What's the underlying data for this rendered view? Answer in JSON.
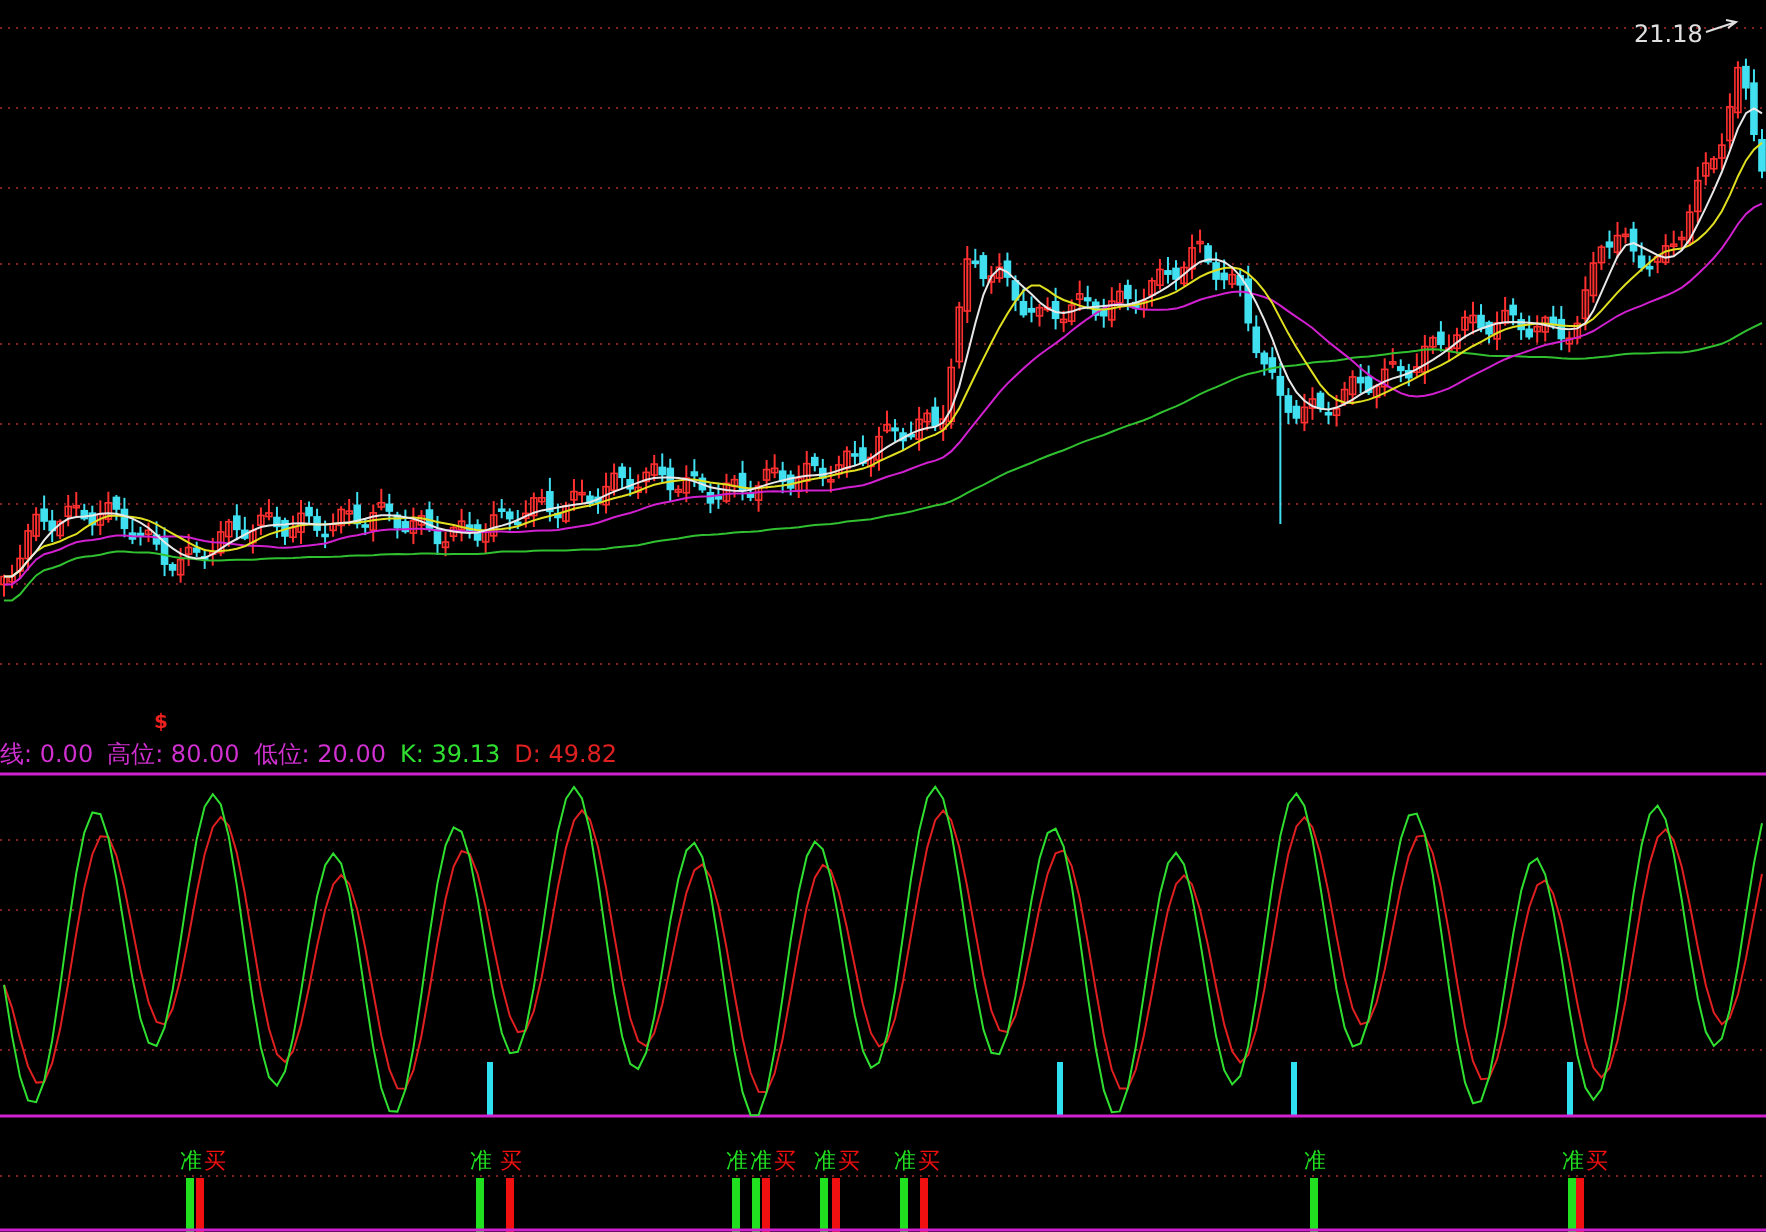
{
  "price_chart": {
    "peak_label": "21.18",
    "marker": "$"
  },
  "indicator": {
    "legend": [
      {
        "text": "线: 0.00",
        "color": "#d030d0"
      },
      {
        "text": "高位: 80.00",
        "color": "#d030d0"
      },
      {
        "text": "低位: 20.00",
        "color": "#d030d0"
      },
      {
        "text": "K: 39.13",
        "color": "#30e030"
      },
      {
        "text": "D: 49.82",
        "color": "#e02020"
      }
    ]
  },
  "signals": [
    {
      "kind": "prep",
      "text": "准"
    },
    {
      "kind": "buy",
      "text": "买"
    },
    {
      "kind": "prep",
      "text": "准"
    },
    {
      "kind": "buy",
      "text": "买"
    },
    {
      "kind": "prep",
      "text": "准"
    },
    {
      "kind": "prep",
      "text": "准"
    },
    {
      "kind": "buy",
      "text": "买"
    },
    {
      "kind": "prep",
      "text": "准"
    },
    {
      "kind": "buy",
      "text": "买"
    },
    {
      "kind": "prep",
      "text": "准"
    },
    {
      "kind": "buy",
      "text": "买"
    },
    {
      "kind": "prep",
      "text": "准"
    },
    {
      "kind": "prep",
      "text": "准"
    },
    {
      "kind": "buy",
      "text": "买"
    }
  ]
}
